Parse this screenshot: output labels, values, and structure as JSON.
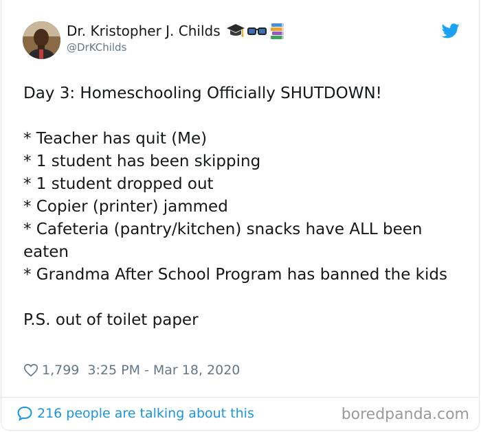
{
  "author": {
    "name": "Dr. Kristopher J. Childs",
    "handle": "@DrKChilds",
    "name_emojis": [
      "graduation-cap-icon",
      "glasses-icon",
      "books-icon"
    ]
  },
  "tweet": {
    "headline": "Day 3: Homeschooling Officially SHUTDOWN!",
    "items": [
      "* Teacher has quit (Me)",
      "* 1 student has been skipping",
      "* 1 student dropped out",
      "* Copier (printer) jammed",
      "* Cafeteria (pantry/kitchen) snacks have ALL been eaten",
      "* Grandma After School Program has banned the kids"
    ],
    "ps": "P.S. out of toilet paper"
  },
  "meta": {
    "likes": "1,799",
    "timestamp": "3:25 PM - Mar 18, 2020"
  },
  "footer": {
    "talking": "216 people are talking about this",
    "watermark": "boredpanda.com"
  },
  "colors": {
    "twitter_blue": "#1da1f2",
    "link_blue": "#1b95e0",
    "text": "#14171a",
    "muted": "#657786"
  }
}
